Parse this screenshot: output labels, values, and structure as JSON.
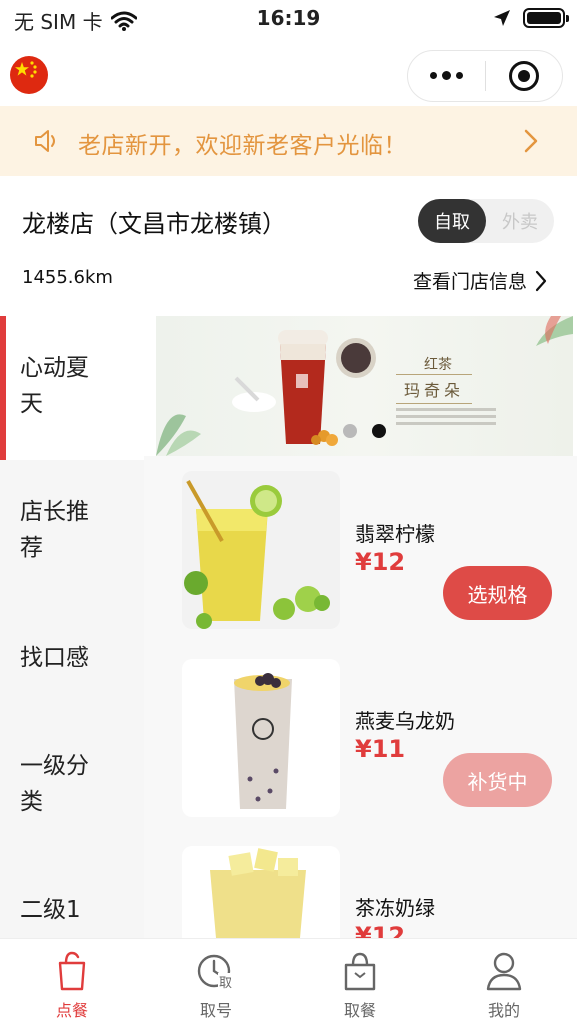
{
  "status_bar": {
    "carrier": "无 SIM 卡",
    "time": "16:19"
  },
  "notice": {
    "text": "老店新开，欢迎新老客户光临！"
  },
  "store": {
    "name": "龙楼店（文昌市龙楼镇）",
    "distance": "1455.6km",
    "info_link": "查看门店信息",
    "modes": [
      "自取",
      "外卖"
    ],
    "active_mode": "自取"
  },
  "categories": [
    {
      "label": "心动夏\n天",
      "active": true
    },
    {
      "label": "店长推\n荐",
      "active": false
    },
    {
      "label": "找口感",
      "active": false
    },
    {
      "label": "一级分\n类",
      "active": false
    },
    {
      "label": "二级1",
      "active": false
    }
  ],
  "banner": {
    "title": "红茶",
    "subtitle": "玛奇朵"
  },
  "products": [
    {
      "name": "翡翠柠檬",
      "price": "¥12",
      "button": "选规格",
      "button_state": "available"
    },
    {
      "name": "燕麦乌龙奶",
      "price": "¥11",
      "button": "补货中",
      "button_state": "restocking"
    },
    {
      "name": "茶冻奶绿",
      "price": "¥12"
    }
  ],
  "tabs": [
    {
      "label": "点餐",
      "icon": "order-bag-icon",
      "active": true
    },
    {
      "label": "取号",
      "icon": "clock-ticket-icon",
      "active": false
    },
    {
      "label": "取餐",
      "icon": "shopping-bag-icon",
      "active": false
    },
    {
      "label": "我的",
      "icon": "user-icon",
      "active": false
    }
  ],
  "colors": {
    "accent": "#e03c3c",
    "notice_text": "#e3953f",
    "notice_bg": "#fdf3e3"
  }
}
